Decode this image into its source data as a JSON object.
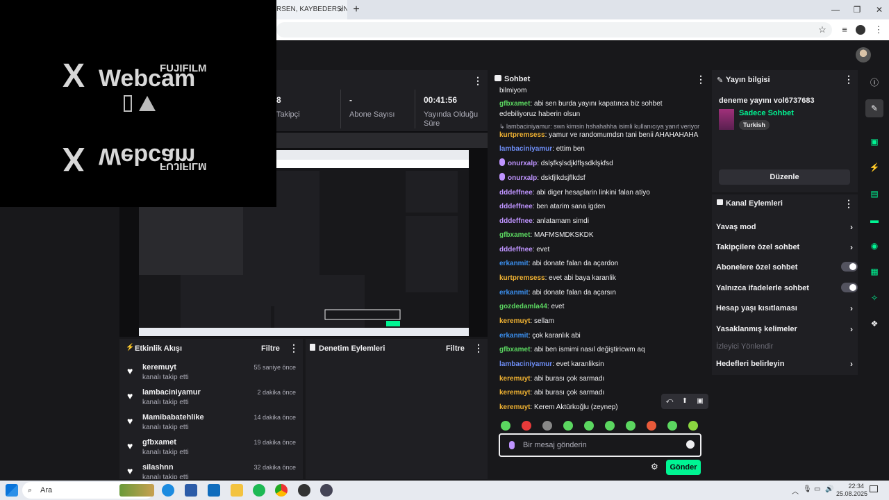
{
  "browser": {
    "tab_title": "RSEN, KAYBEDERSİN! |",
    "tab_close": "×",
    "tab_new": "+",
    "window_minimize": "—",
    "window_restore": "❐",
    "window_close": "✕"
  },
  "webcam": {
    "brand_top": "FUJIFILM",
    "product": "Webcam",
    "brand_mirror": "FUJIFILM",
    "product_mirror": "Webcam",
    "x_mark": "X"
  },
  "stats": {
    "followers_value": "8",
    "followers_label": "Takipçi",
    "subs_value": "-",
    "subs_label": "Abone Sayısı",
    "live_value": "00:41:56",
    "live_label_1": "Yayında Olduğu",
    "live_label_2": "Süre",
    "menu": "⋮"
  },
  "activity": {
    "title": "Etkinlik Akışı",
    "filter": "Filtre",
    "menu": "⋮",
    "items": [
      {
        "name": "keremuyt",
        "sub": "kanalı takip etti",
        "time": "55 saniye önce"
      },
      {
        "name": "lambaciniyamur",
        "sub": "kanalı takip etti",
        "time": "2 dakika önce"
      },
      {
        "name": "Mamibabatehlike",
        "sub": "kanalı takip etti",
        "time": "14 dakika önce"
      },
      {
        "name": "gfbxamet",
        "sub": "kanalı takip etti",
        "time": "19 dakika önce"
      },
      {
        "name": "silashnn",
        "sub": "kanalı takip etti",
        "time": "32 dakika önce"
      }
    ]
  },
  "moderation": {
    "title": "Denetim Eylemleri",
    "filter": "Filtre",
    "menu": "⋮"
  },
  "chat": {
    "title": "Sohbet",
    "menu": "⋮",
    "messages": [
      {
        "user": "",
        "text": "bilmiyom",
        "color": "#efeff1"
      },
      {
        "user": "gfbxamet",
        "text": "abi sen burda yayını kapatınca biz sohbet edebiliyoruz haberin olsun",
        "color": "#5bd660"
      },
      {
        "user": "",
        "text": "↳ lambaciniyamur: swn kimsin hshahahha isimli kullanıcıya yanıt veriyor",
        "color": "#adadb8",
        "reply": true
      },
      {
        "user": "kurtpremsess",
        "text": "yamur ve randomumdsn tani benii AHAHAHAHA",
        "color": "#f0b232"
      },
      {
        "user": "lambaciniyamur",
        "text": "ettim ben",
        "color": "#6e8ef7"
      },
      {
        "user": "onurxalp",
        "text": "dslşfkşlsdjklflşsdklşkfsd",
        "color": "#bf94ff",
        "mic": true
      },
      {
        "user": "onurxalp",
        "text": "dskfjlkdsjflkdsf",
        "color": "#bf94ff",
        "mic": true
      },
      {
        "user": "dddeffnee",
        "text": "abi diger hesaplarin linkini falan atiyo",
        "color": "#bf94ff"
      },
      {
        "user": "dddeffnee",
        "text": "ben atarim sana igden",
        "color": "#bf94ff"
      },
      {
        "user": "dddeffnee",
        "text": "anlatamam simdi",
        "color": "#bf94ff"
      },
      {
        "user": "gfbxamet",
        "text": "MAFMSMDKSKDK",
        "color": "#5bd660"
      },
      {
        "user": "dddeffnee",
        "text": "evet",
        "color": "#bf94ff"
      },
      {
        "user": "erkanmit",
        "text": "abi donate falan da açardon",
        "color": "#3a8eed"
      },
      {
        "user": "kurtpremsess",
        "text": "evet abi baya karanlik",
        "color": "#f0b232"
      },
      {
        "user": "erkanmit",
        "text": "abi donate falan da açarsın",
        "color": "#3a8eed"
      },
      {
        "user": "gozdedamla44",
        "text": "evet",
        "color": "#5bd660"
      },
      {
        "user": "keremuyt",
        "text": "sellam",
        "color": "#f0b232"
      },
      {
        "user": "erkanmit",
        "text": "çok karanlık abi",
        "color": "#3a8eed"
      },
      {
        "user": "gfbxamet",
        "text": "abi ben ismimi nasıl değiştiricwm aq",
        "color": "#5bd660"
      },
      {
        "user": "lambaciniyamur",
        "text": "evet karanliksin",
        "color": "#6e8ef7"
      },
      {
        "user": "keremuyt",
        "text": "abi burası çok sarmadı",
        "color": "#f0b232"
      },
      {
        "user": "keremuyt",
        "text": "abi burası çok sarmadı",
        "color": "#f0b232"
      },
      {
        "user": "keremuyt",
        "text": "Kerem Aktürkoğlu (zeynep)",
        "color": "#f0b232"
      }
    ],
    "input_placeholder": "Bir mesaj gönderin",
    "send_label": "Gönder",
    "msg_action_reply": "⤺",
    "msg_action_pin": "📌",
    "msg_action_delete": "🗑"
  },
  "stream_info": {
    "title": "Yayın bilgisi",
    "menu": "⋮",
    "stream_title": "deneme yayını vol6737683",
    "category": "Sadece Sohbet",
    "tag": "Turkish",
    "edit_label": "Düzenle"
  },
  "channel_actions": {
    "title": "Kanal Eylemleri",
    "menu": "⋮",
    "items": [
      {
        "label": "Yavaş mod",
        "kind": "chevron",
        "disabled": false
      },
      {
        "label": "Takipçilere özel sohbet",
        "kind": "chevron",
        "disabled": false
      },
      {
        "label": "Abonelere özel sohbet",
        "kind": "toggle",
        "disabled": false
      },
      {
        "label": "Yalnızca ifadelerle sohbet",
        "kind": "toggle",
        "disabled": false
      },
      {
        "label": "Hesap yaşı kısıtlaması",
        "kind": "chevron",
        "disabled": false
      },
      {
        "label": "Yasaklanmış kelimeler",
        "kind": "chevron",
        "disabled": false
      },
      {
        "label": "İzleyici Yönlendir",
        "kind": "none",
        "disabled": true
      },
      {
        "label": "Hedefleri belirleyin",
        "kind": "chevron",
        "disabled": false
      }
    ]
  },
  "taskbar": {
    "search_label": "Ara",
    "time": "22:34",
    "date": "25.08.2025"
  },
  "colors": {
    "accent": "#9147ff",
    "send": "#00f593",
    "panel": "#1f1f23",
    "bg": "#18181b"
  }
}
